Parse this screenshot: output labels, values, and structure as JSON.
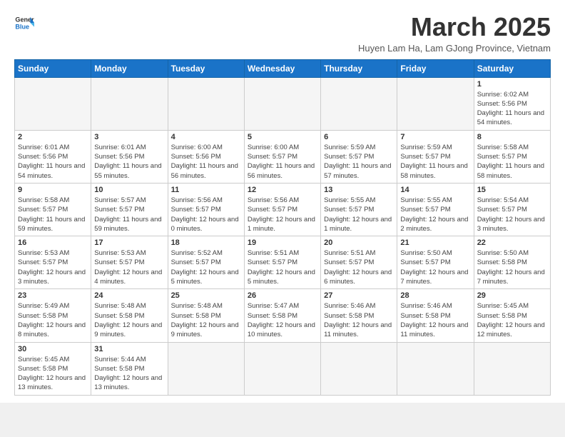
{
  "logo": {
    "line1": "General",
    "line2": "Blue"
  },
  "title": "March 2025",
  "subtitle": "Huyen Lam Ha, Lam GJong Province, Vietnam",
  "weekdays": [
    "Sunday",
    "Monday",
    "Tuesday",
    "Wednesday",
    "Thursday",
    "Friday",
    "Saturday"
  ],
  "weeks": [
    [
      {
        "day": "",
        "info": ""
      },
      {
        "day": "",
        "info": ""
      },
      {
        "day": "",
        "info": ""
      },
      {
        "day": "",
        "info": ""
      },
      {
        "day": "",
        "info": ""
      },
      {
        "day": "",
        "info": ""
      },
      {
        "day": "1",
        "info": "Sunrise: 6:02 AM\nSunset: 5:56 PM\nDaylight: 11 hours and 54 minutes."
      }
    ],
    [
      {
        "day": "2",
        "info": "Sunrise: 6:01 AM\nSunset: 5:56 PM\nDaylight: 11 hours and 54 minutes."
      },
      {
        "day": "3",
        "info": "Sunrise: 6:01 AM\nSunset: 5:56 PM\nDaylight: 11 hours and 55 minutes."
      },
      {
        "day": "4",
        "info": "Sunrise: 6:00 AM\nSunset: 5:56 PM\nDaylight: 11 hours and 56 minutes."
      },
      {
        "day": "5",
        "info": "Sunrise: 6:00 AM\nSunset: 5:57 PM\nDaylight: 11 hours and 56 minutes."
      },
      {
        "day": "6",
        "info": "Sunrise: 5:59 AM\nSunset: 5:57 PM\nDaylight: 11 hours and 57 minutes."
      },
      {
        "day": "7",
        "info": "Sunrise: 5:59 AM\nSunset: 5:57 PM\nDaylight: 11 hours and 58 minutes."
      },
      {
        "day": "8",
        "info": "Sunrise: 5:58 AM\nSunset: 5:57 PM\nDaylight: 11 hours and 58 minutes."
      }
    ],
    [
      {
        "day": "9",
        "info": "Sunrise: 5:58 AM\nSunset: 5:57 PM\nDaylight: 11 hours and 59 minutes."
      },
      {
        "day": "10",
        "info": "Sunrise: 5:57 AM\nSunset: 5:57 PM\nDaylight: 11 hours and 59 minutes."
      },
      {
        "day": "11",
        "info": "Sunrise: 5:56 AM\nSunset: 5:57 PM\nDaylight: 12 hours and 0 minutes."
      },
      {
        "day": "12",
        "info": "Sunrise: 5:56 AM\nSunset: 5:57 PM\nDaylight: 12 hours and 1 minute."
      },
      {
        "day": "13",
        "info": "Sunrise: 5:55 AM\nSunset: 5:57 PM\nDaylight: 12 hours and 1 minute."
      },
      {
        "day": "14",
        "info": "Sunrise: 5:55 AM\nSunset: 5:57 PM\nDaylight: 12 hours and 2 minutes."
      },
      {
        "day": "15",
        "info": "Sunrise: 5:54 AM\nSunset: 5:57 PM\nDaylight: 12 hours and 3 minutes."
      }
    ],
    [
      {
        "day": "16",
        "info": "Sunrise: 5:53 AM\nSunset: 5:57 PM\nDaylight: 12 hours and 3 minutes."
      },
      {
        "day": "17",
        "info": "Sunrise: 5:53 AM\nSunset: 5:57 PM\nDaylight: 12 hours and 4 minutes."
      },
      {
        "day": "18",
        "info": "Sunrise: 5:52 AM\nSunset: 5:57 PM\nDaylight: 12 hours and 5 minutes."
      },
      {
        "day": "19",
        "info": "Sunrise: 5:51 AM\nSunset: 5:57 PM\nDaylight: 12 hours and 5 minutes."
      },
      {
        "day": "20",
        "info": "Sunrise: 5:51 AM\nSunset: 5:57 PM\nDaylight: 12 hours and 6 minutes."
      },
      {
        "day": "21",
        "info": "Sunrise: 5:50 AM\nSunset: 5:57 PM\nDaylight: 12 hours and 7 minutes."
      },
      {
        "day": "22",
        "info": "Sunrise: 5:50 AM\nSunset: 5:58 PM\nDaylight: 12 hours and 7 minutes."
      }
    ],
    [
      {
        "day": "23",
        "info": "Sunrise: 5:49 AM\nSunset: 5:58 PM\nDaylight: 12 hours and 8 minutes."
      },
      {
        "day": "24",
        "info": "Sunrise: 5:48 AM\nSunset: 5:58 PM\nDaylight: 12 hours and 9 minutes."
      },
      {
        "day": "25",
        "info": "Sunrise: 5:48 AM\nSunset: 5:58 PM\nDaylight: 12 hours and 9 minutes."
      },
      {
        "day": "26",
        "info": "Sunrise: 5:47 AM\nSunset: 5:58 PM\nDaylight: 12 hours and 10 minutes."
      },
      {
        "day": "27",
        "info": "Sunrise: 5:46 AM\nSunset: 5:58 PM\nDaylight: 12 hours and 11 minutes."
      },
      {
        "day": "28",
        "info": "Sunrise: 5:46 AM\nSunset: 5:58 PM\nDaylight: 12 hours and 11 minutes."
      },
      {
        "day": "29",
        "info": "Sunrise: 5:45 AM\nSunset: 5:58 PM\nDaylight: 12 hours and 12 minutes."
      }
    ],
    [
      {
        "day": "30",
        "info": "Sunrise: 5:45 AM\nSunset: 5:58 PM\nDaylight: 12 hours and 13 minutes."
      },
      {
        "day": "31",
        "info": "Sunrise: 5:44 AM\nSunset: 5:58 PM\nDaylight: 12 hours and 13 minutes."
      },
      {
        "day": "",
        "info": ""
      },
      {
        "day": "",
        "info": ""
      },
      {
        "day": "",
        "info": ""
      },
      {
        "day": "",
        "info": ""
      },
      {
        "day": "",
        "info": ""
      }
    ]
  ]
}
